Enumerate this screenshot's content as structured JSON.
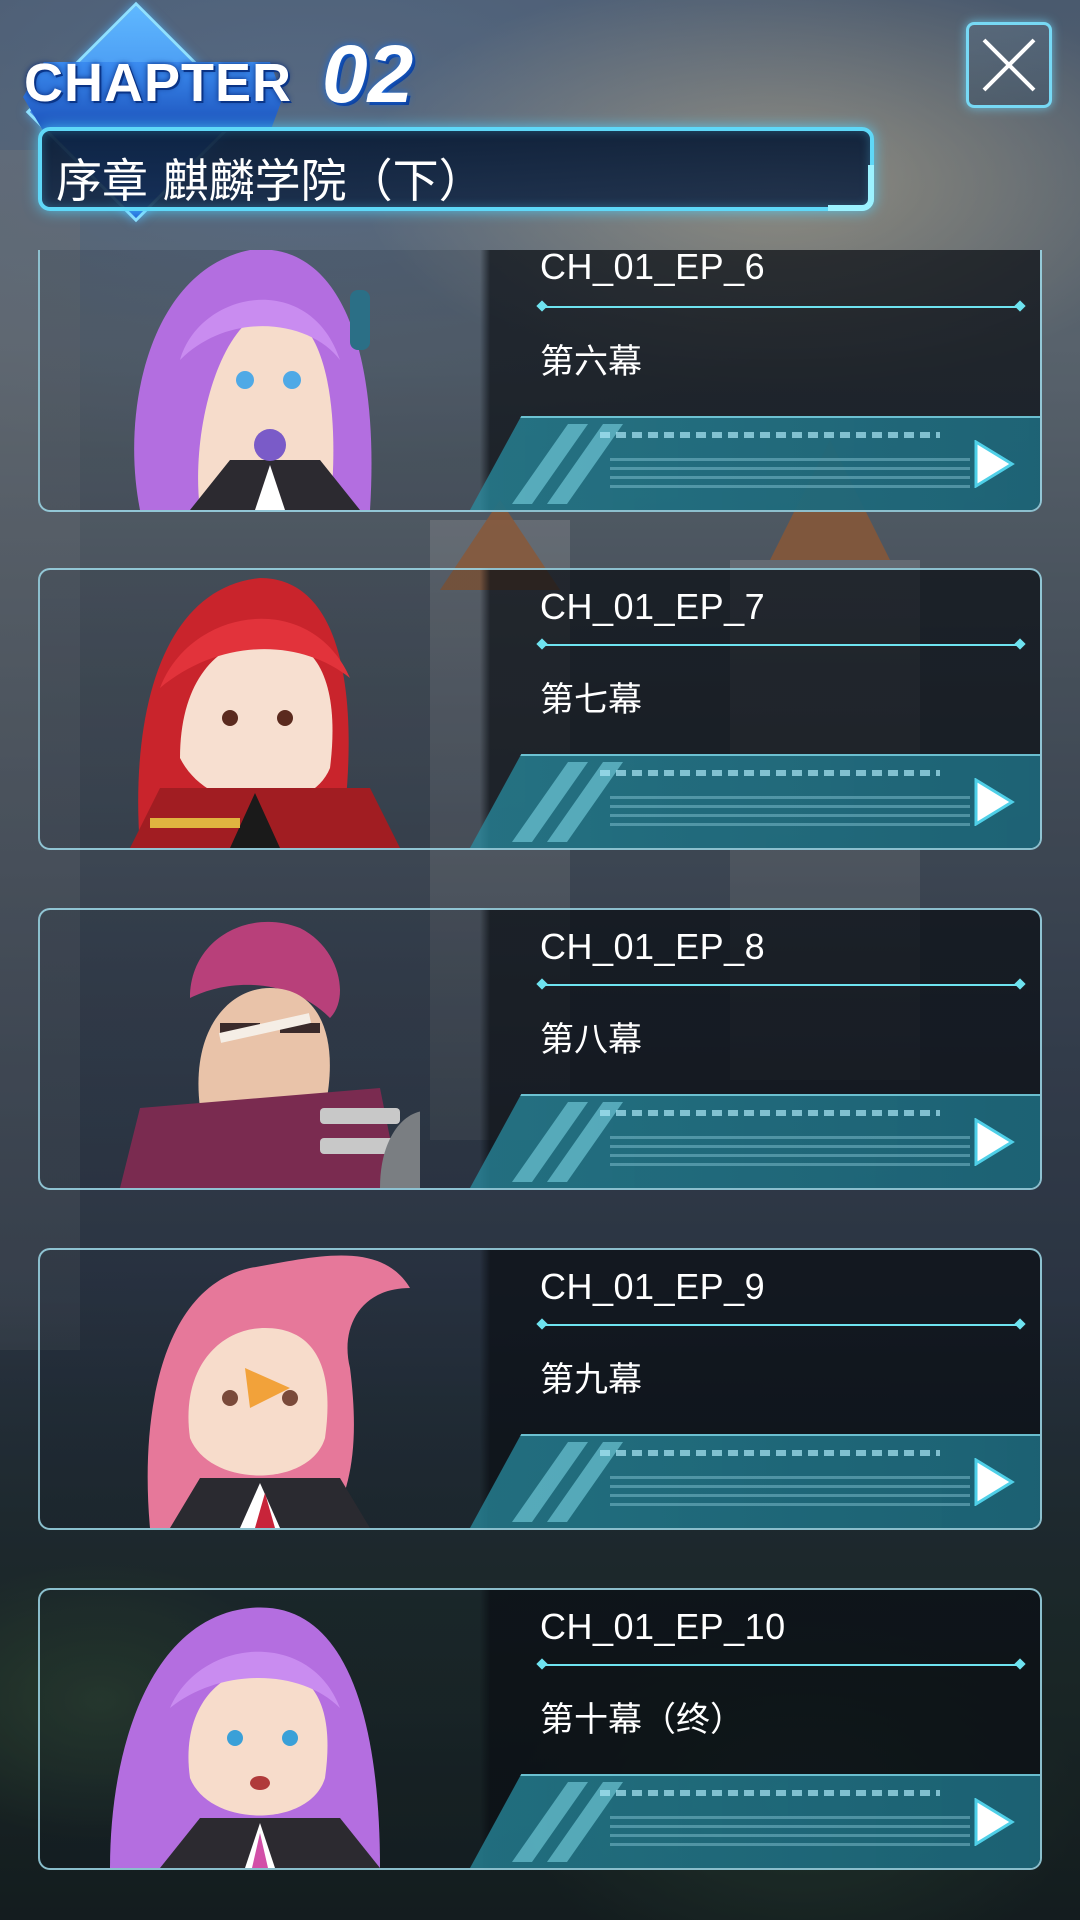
{
  "header": {
    "chapter_label": "CHAPTER",
    "chapter_number": "02",
    "chapter_title": "序章 麒麟学院（下）",
    "close_icon": "close-icon"
  },
  "episodes": [
    {
      "code": "CH_01_EP_6",
      "title": "第六幕",
      "portrait": "purple-hair-girl-headphones"
    },
    {
      "code": "CH_01_EP_7",
      "title": "第七幕",
      "portrait": "red-hair-uniform-girl"
    },
    {
      "code": "CH_01_EP_8",
      "title": "第八幕",
      "portrait": "scarred-man-pink-hair"
    },
    {
      "code": "CH_01_EP_9",
      "title": "第九幕",
      "portrait": "pink-ponytail-girl"
    },
    {
      "code": "CH_01_EP_10",
      "title": "第十幕（终）",
      "portrait": "purple-hair-girl-angry"
    }
  ],
  "colors": {
    "accent": "#6ee3f0",
    "frame": "#5fd8f8",
    "chapter_blue": "#1f5fd8"
  }
}
